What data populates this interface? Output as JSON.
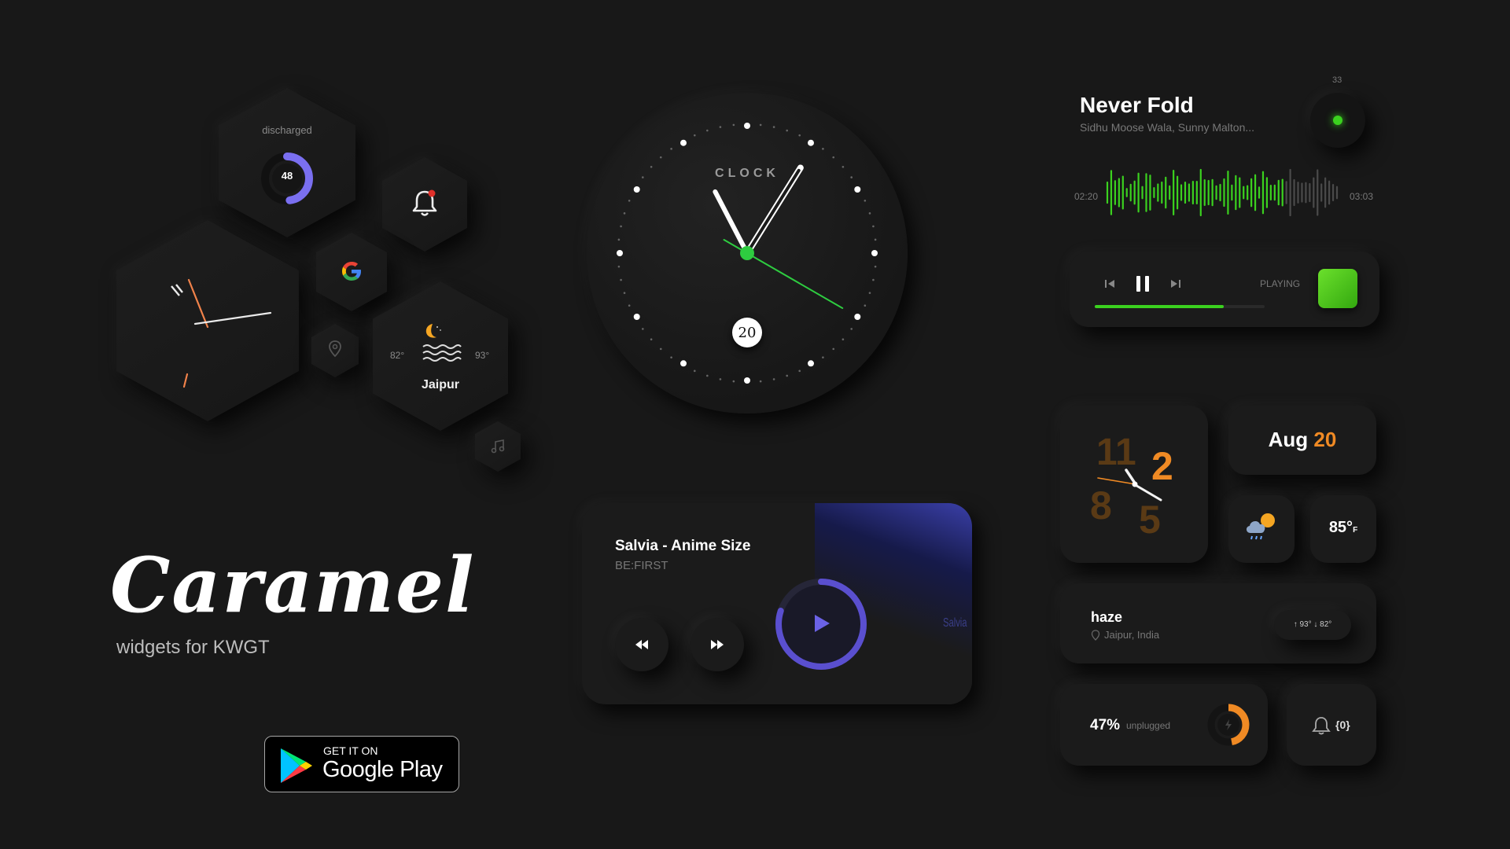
{
  "battery_hex": {
    "caption": "discharged",
    "value": "48",
    "level": 0.48,
    "color": "#7a6ff0"
  },
  "weather_hex": {
    "low": "82°",
    "high": "93°",
    "city": "Jaipur"
  },
  "brand": {
    "title": "Caramel",
    "subtitle": "widgets for KWGT"
  },
  "google_play": {
    "line1": "GET IT ON",
    "line2": "Google Play"
  },
  "clock": {
    "label": "CLOCK",
    "date": "20",
    "hour": 11,
    "minute": 5,
    "second": 20,
    "accent": "#2ecc40"
  },
  "music_top": {
    "title": "Never Fold",
    "artist": "Sidhu Moose Wala, Sunny Malton...",
    "elapsed": "02:20",
    "total": "03:03",
    "count": "33",
    "status": "PLAYING",
    "progress": 0.76,
    "accent": "#3bd11f"
  },
  "player_card": {
    "title": "Salvia - Anime Size",
    "artist": "BE:FIRST",
    "art_text": "Salvia",
    "progress": 0.8,
    "accent": "#5a4fcf"
  },
  "num_clock": {
    "n1": "11",
    "n2": "2",
    "n3": "8",
    "n4": "5"
  },
  "date_widget": {
    "month": "Aug",
    "day": "20"
  },
  "temp_widget": {
    "value": "85°",
    "unit": "F"
  },
  "haze_widget": {
    "title": "haze",
    "location": "Jaipur, India",
    "high": "↑ 93°",
    "low": "↓ 82°"
  },
  "battery_widget": {
    "value": "47%",
    "caption": "unplugged",
    "level": 0.47,
    "color": "#f08a24"
  },
  "notif_widget": {
    "count": "{0}"
  },
  "icons": [
    "bell-icon",
    "google-icon",
    "location-pin-icon",
    "music-note-icon",
    "moon-icon",
    "waves-icon",
    "prev-icon",
    "pause-icon",
    "next-icon",
    "rewind-icon",
    "fast-forward-icon",
    "play-icon",
    "cloud-rain-icon",
    "bolt-icon",
    "play-store-icon"
  ]
}
